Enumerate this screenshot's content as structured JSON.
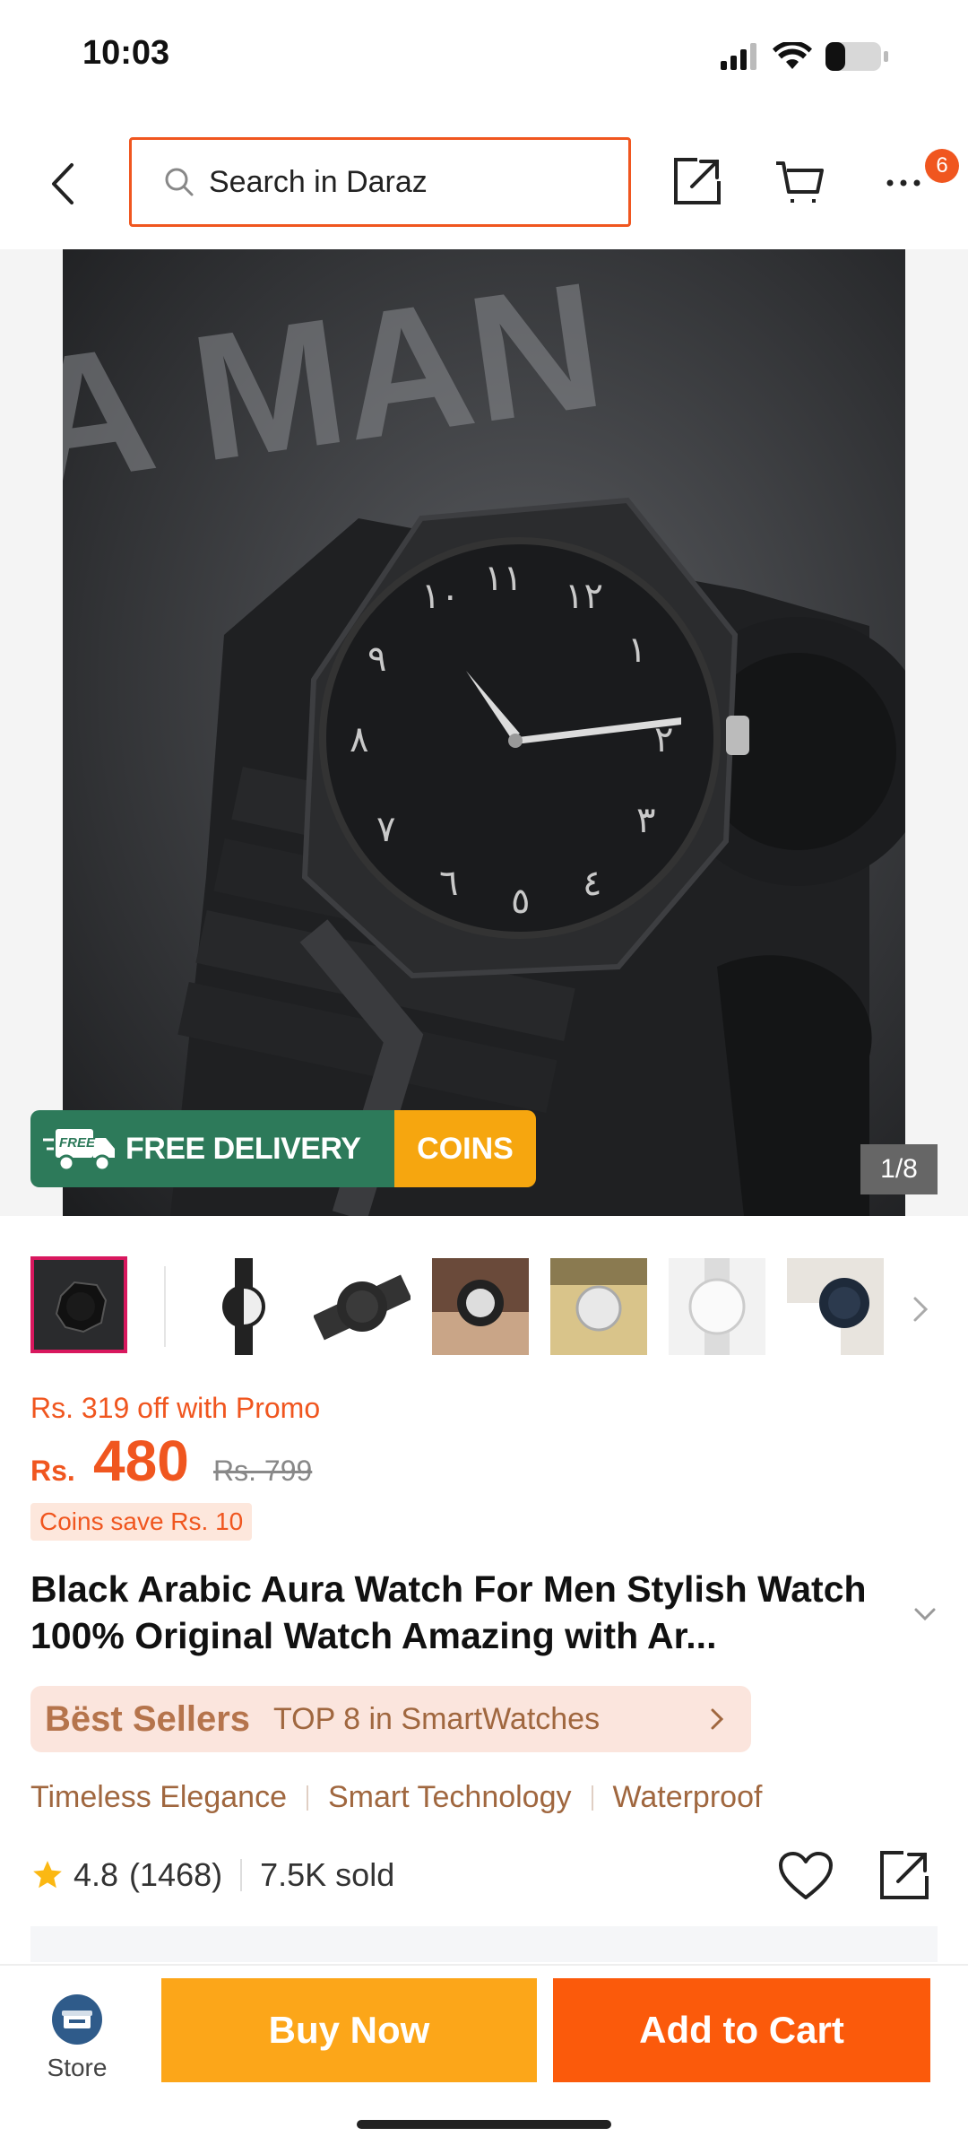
{
  "status_bar": {
    "time": "10:03"
  },
  "header": {
    "search_placeholder": "Search in Daraz",
    "cart_badge": "6"
  },
  "gallery": {
    "banner_free_badge": "FREE",
    "banner_free_delivery": "FREE DELIVERY",
    "banner_coins": "COINS",
    "counter": "1/8",
    "thumbnail_count": 7
  },
  "price": {
    "promo_text": "Rs. 319 off with Promo",
    "currency": "Rs.",
    "current": "480",
    "original": "Rs. 799",
    "coins_save": "Coins save Rs. 10"
  },
  "product": {
    "title": "Black Arabic Aura Watch For Men Stylish Watch 100% Original Watch Amazing with Ar...",
    "best_seller_label": "Bëst Sellers",
    "best_seller_rank": "TOP 8 in SmartWatches",
    "tags": [
      "Timeless Elegance",
      "Smart Technology",
      "Waterproof"
    ],
    "rating": "4.8",
    "rating_count": "(1468)",
    "sold": "7.5K sold"
  },
  "bottom_bar": {
    "store_label": "Store",
    "buy_now": "Buy Now",
    "add_to_cart": "Add to Cart"
  },
  "colors": {
    "accent": "#f0561f",
    "buy_now": "#fca619",
    "add_to_cart": "#fb5a0b",
    "free_delivery_green": "#2d7a5a",
    "coins_yellow": "#f6a60f",
    "active_thumb_border": "#d8185e"
  }
}
